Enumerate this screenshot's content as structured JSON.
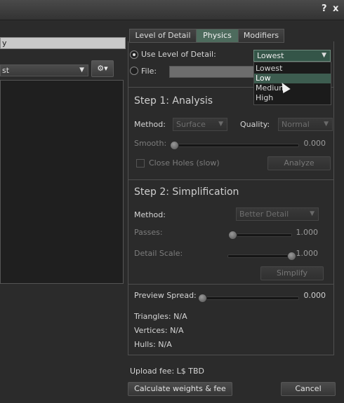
{
  "window": {
    "help_label": "?",
    "close_label": "x"
  },
  "left": {
    "name_value": "y",
    "combo_value": "st",
    "gear_label": "⚙▾"
  },
  "tabs": [
    {
      "label": "Level of Detail"
    },
    {
      "label": "Physics"
    },
    {
      "label": "Modifiers"
    }
  ],
  "source": {
    "use_lod_label": "Use Level of Detail:",
    "lod_selected": "Lowest",
    "file_label": "File:",
    "file_value": ""
  },
  "lod_dropdown": {
    "options": [
      {
        "label": "Lowest"
      },
      {
        "label": "Low"
      },
      {
        "label": "Medium"
      },
      {
        "label": "High"
      }
    ]
  },
  "step1": {
    "title": "Step 1: Analysis",
    "method_label": "Method:",
    "method_value": "Surface",
    "quality_label": "Quality:",
    "quality_value": "Normal",
    "smooth_label": "Smooth:",
    "smooth_value": "0.000",
    "close_holes_label": "Close Holes (slow)",
    "analyze_label": "Analyze"
  },
  "step2": {
    "title": "Step 2: Simplification",
    "method_label": "Method:",
    "method_value": "Better Detail",
    "passes_label": "Passes:",
    "passes_value": "1.000",
    "detail_scale_label": "Detail Scale:",
    "detail_scale_value": "1.000",
    "simplify_label": "Simplify"
  },
  "preview": {
    "spread_label": "Preview Spread:",
    "spread_value": "0.000",
    "triangles": "Triangles: N/A",
    "vertices": "Vertices: N/A",
    "hulls": "Hulls: N/A"
  },
  "footer": {
    "upload_fee": "Upload fee: L$ TBD",
    "calculate_label": "Calculate weights & fee",
    "cancel_label": "Cancel"
  }
}
